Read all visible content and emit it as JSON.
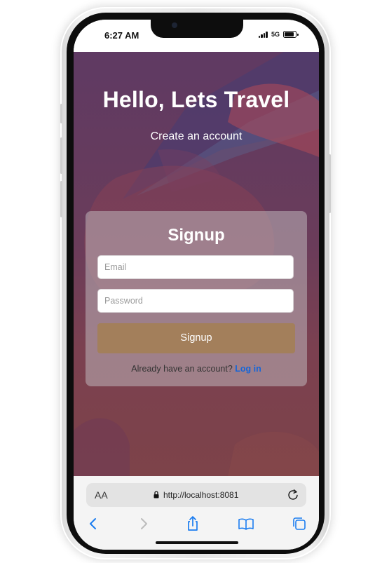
{
  "status_bar": {
    "time": "6:27 AM",
    "network": "5G"
  },
  "hero": {
    "title": "Hello, Lets Travel",
    "subtitle": "Create an account"
  },
  "signup_form": {
    "title": "Signup",
    "email_placeholder": "Email",
    "email_value": "",
    "password_placeholder": "Password",
    "password_value": "",
    "submit_label": "Signup",
    "login_prompt": "Already have an account?",
    "login_link": "Log in"
  },
  "browser": {
    "text_size_label": "AA",
    "url": "http://localhost:8081",
    "icons": [
      "lock-icon",
      "reload-icon",
      "back-icon",
      "forward-icon",
      "share-icon",
      "bookmarks-icon",
      "tabs-icon"
    ]
  },
  "colors": {
    "background_top": "#5f3a63",
    "background_bottom": "#7d4349",
    "button": "#a37f5b",
    "link": "#1565d8"
  }
}
